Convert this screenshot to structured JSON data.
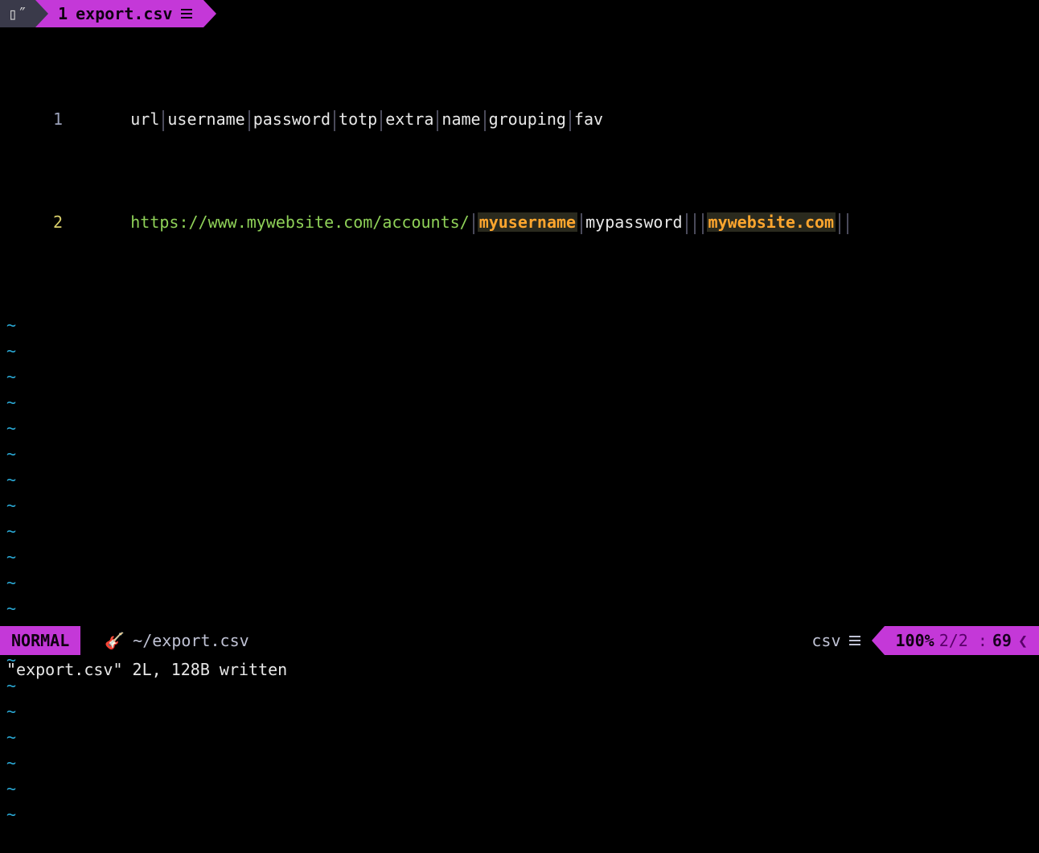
{
  "tab": {
    "index": "1",
    "filename": "export.csv"
  },
  "buffer": {
    "lines": [
      {
        "num": "1",
        "fields": [
          "url",
          "username",
          "password",
          "totp",
          "extra",
          "name",
          "grouping",
          "fav"
        ]
      },
      {
        "num": "2",
        "fields": [
          "https://www.mywebsite.com/accounts/",
          "myusername",
          "mypassword",
          "",
          "",
          "mywebsite.com",
          "",
          ""
        ]
      }
    ],
    "tilde_rows": 20,
    "tilde_char": "~"
  },
  "status": {
    "mode": "NORMAL",
    "branch_icon": "🎸",
    "filepath": "~/export.csv",
    "filetype": "csv",
    "percent": "100%",
    "line_info": "2/2",
    "col": "69"
  },
  "cmdline": "\"export.csv\" 2L, 128B written"
}
